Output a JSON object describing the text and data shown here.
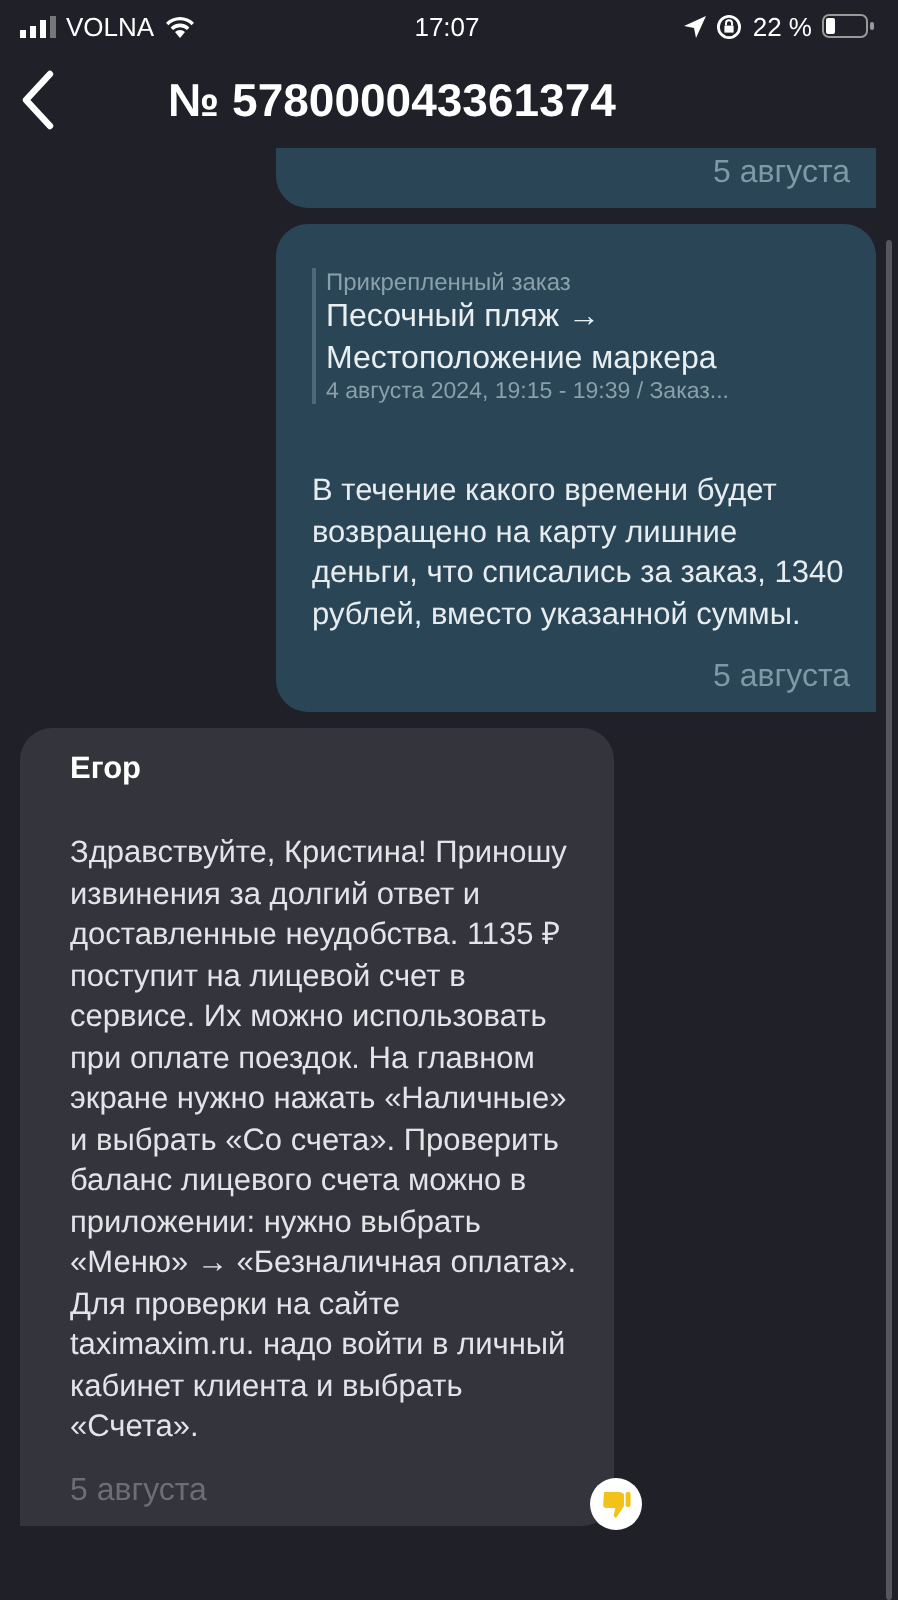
{
  "status_bar": {
    "carrier": "VOLNA",
    "time": "17:07",
    "battery": "22 %"
  },
  "header": {
    "title": "№ 578000043361374"
  },
  "messages": [
    {
      "kind": "outgoing",
      "cut_top": true,
      "time": "5 августа"
    },
    {
      "kind": "outgoing",
      "cut_top": false,
      "attachment": {
        "caption": "Прикрепленный заказ",
        "title": "Песочный пляж → Местоположение маркера",
        "details": "4 августа 2024, 19:15 - 19:39 / Заказ..."
      },
      "text": "В течение какого времени будет возвращено на карту лишние деньги, что списались за заказ, 1340 рублей, вместо указанной суммы.",
      "time": "5 августа"
    },
    {
      "kind": "incoming",
      "cut_top": false,
      "author": "Егор",
      "text": "Здравствуйте, Кристина! Приношу извинения за долгий ответ и доставленные неудобства. 1135 ₽ поступит на лицевой счет в сервисе. Их можно использовать при оплате поездок. На главном экране нужно нажать «Наличные» и выбрать «Со счета». Проверить баланс лицевого счета можно в приложении: нужно выбрать «Меню» → «Безналичная оплата». Для проверки на сайте taximaxim.ru. надо войти в личный кабинет клиента и выбрать «Счета».",
      "time": "5 августа"
    }
  ]
}
